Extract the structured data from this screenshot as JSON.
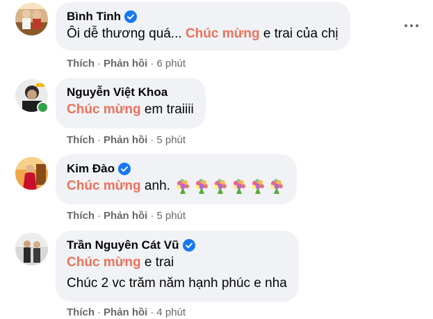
{
  "comments": [
    {
      "author": "Bình Tinh",
      "verified": true,
      "online": false,
      "lines": [
        {
          "before": "Ôi dễ thương quá... ",
          "highlight": "Chúc mừng",
          "after": " e trai của chị"
        }
      ],
      "actions": {
        "like": "Thích",
        "reply": "Phản hồi",
        "time": "6 phút"
      }
    },
    {
      "author": "Nguyễn Việt Khoa",
      "verified": false,
      "online": true,
      "lines": [
        {
          "before": "",
          "highlight": "Chúc mừng",
          "after": " em traiiii"
        }
      ],
      "actions": {
        "like": "Thích",
        "reply": "Phản hồi",
        "time": "5 phút"
      }
    },
    {
      "author": "Kim Đào",
      "verified": true,
      "online": false,
      "lines": [
        {
          "before": "",
          "highlight": "Chúc mừng",
          "after": " anh."
        }
      ],
      "emoji_count": 6,
      "emoji_name": "bouquet-emoji",
      "actions": {
        "like": "Thích",
        "reply": "Phản hồi",
        "time": "5 phút"
      }
    },
    {
      "author": "Trần Nguyên Cát Vũ",
      "verified": true,
      "online": false,
      "lines": [
        {
          "before": "",
          "highlight": "Chúc mừng",
          "after": " e trai"
        },
        {
          "before": "Chúc 2 vc trăm năm hạnh phúc e nha",
          "highlight": "",
          "after": ""
        }
      ],
      "actions": {
        "like": "Thích",
        "reply": "Phản hồi",
        "time": "4 phút"
      }
    }
  ],
  "more_icon": "more-horizontal-icon",
  "colors": {
    "highlight": "#e9725a",
    "bubble": "#f0f2f5",
    "verified": "#1877f2",
    "meta": "#65676b",
    "online": "#31a24c"
  }
}
